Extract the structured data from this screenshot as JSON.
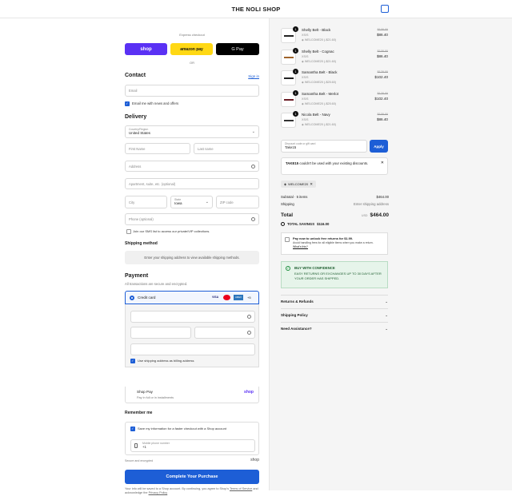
{
  "header": {
    "store_name": "THE NOLI SHOP"
  },
  "express": {
    "label": "Express checkout",
    "shop_label": "shop",
    "amazon_label": "amazon pay",
    "gpay_label": "G Pay",
    "or": "OR"
  },
  "contact": {
    "heading": "Contact",
    "sign_in": "Sign in",
    "email_placeholder": "Email",
    "news_label": "Email me with news and offers"
  },
  "delivery": {
    "heading": "Delivery",
    "country_label": "Country/Region",
    "country_value": "United States",
    "first_name": "First Name",
    "last_name": "Last name",
    "address": "Address",
    "apartment": "Apartment, suite, etc. (optional)",
    "city": "City",
    "state_label": "State",
    "state_value": "Iowa",
    "zip": "ZIP code",
    "phone": "Phone (optional)",
    "sms_label": "Join our SMS list to access our private/VIP collections."
  },
  "shipping_method": {
    "heading": "Shipping method",
    "note": "Enter your shipping address to view available shipping methods."
  },
  "payment": {
    "heading": "Payment",
    "subtitle": "All transactions are secure and encrypted.",
    "credit_card": "Credit card",
    "card_badges": [
      "VISA",
      "MC",
      "AMEX",
      "+5"
    ],
    "billing_label": "Use shipping address as billing address",
    "shop_pay": "Shop Pay",
    "shop_pay_sub": "Pay in full or in installments",
    "shop_pay_logo": "shop"
  },
  "remember": {
    "heading": "Remember me",
    "save_label": "Save my information for a faster checkout with a Shop account",
    "mobile_label": "Mobile phone number",
    "mobile_value": "+1",
    "secure": "Secure and encrypted",
    "shop_logo": "shop"
  },
  "complete_button": "Complete Your Purchase",
  "legal": {
    "text": "Your info will be saved to a Shop account. By continuing, you agree to Shop's",
    "terms": "Terms of Service",
    "and": "and acknowledge the",
    "privacy": "Privacy Policy"
  },
  "products": [
    {
      "qty": "1",
      "name": "Shelly Belt - Black",
      "variant": "XS/S",
      "discount": "WELCOME20 (-$21.60)",
      "old": "$108.00",
      "new": "$86.40",
      "color": "#222222"
    },
    {
      "qty": "1",
      "name": "Shelly Belt - Cognac",
      "variant": "XS/S",
      "discount": "WELCOME20 (-$21.60)",
      "old": "$108.00",
      "new": "$86.40",
      "color": "#a0642a"
    },
    {
      "qty": "1",
      "name": "Samantha Belt - Black",
      "variant": "XS/S",
      "discount": "WELCOME20 (-$25.60)",
      "old": "$128.00",
      "new": "$102.40",
      "color": "#222222"
    },
    {
      "qty": "1",
      "name": "Samantha Belt - Merlot",
      "variant": "XS/S",
      "discount": "WELCOME20 (-$25.60)",
      "old": "$128.00",
      "new": "$102.40",
      "color": "#6b1c25"
    },
    {
      "qty": "1",
      "name": "Nicola Belt - Navy",
      "variant": "XS/S",
      "discount": "WELCOME20 (-$21.60)",
      "old": "$108.00",
      "new": "$86.40",
      "color": "#333333"
    }
  ],
  "discount": {
    "label": "Discount code or gift card",
    "value": "Take15",
    "apply": "Apply",
    "error_code": "TAKE15",
    "error_text": "couldn't be used with your existing discounts.",
    "tag": "WELCOME20"
  },
  "summary": {
    "subtotal_label": "Subtotal · 5 items",
    "subtotal": "$464.00",
    "shipping_label": "Shipping",
    "shipping": "Enter shipping address",
    "total_label": "Total",
    "currency": "USD",
    "total": "$464.00",
    "savings_label": "TOTAL SAVINGS",
    "savings": "$116.00"
  },
  "returns_box": {
    "title": "Pay now to unlock free returns for $1.99.",
    "text": "Avoid handling fees for all eligible items when you make a return.",
    "link": "What's this?"
  },
  "confidence": {
    "title": "BUY WITH CONFIDENCE",
    "text": "EASY RETURNS OR EXCHANGES UP TO 30 DAYS AFTER YOUR ORDER HAS SHIPPED."
  },
  "accordions": [
    "Returns & Refunds",
    "Shipping Policy",
    "Need Assistance?"
  ],
  "colors": {
    "accent": "#1d5ed6",
    "shop": "#5a31f4",
    "amazon": "#ffd814",
    "gpay": "#000000",
    "confidence_bg": "#e6f4ea"
  }
}
